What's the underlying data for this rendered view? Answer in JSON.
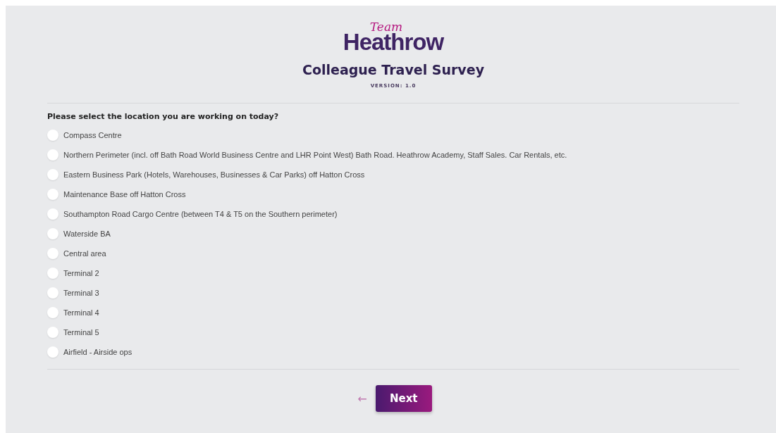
{
  "logo": {
    "top": "Team",
    "main": "Heathrow"
  },
  "title": "Colleague Travel Survey",
  "version": "VERSION: 1.0",
  "question": "Please select the location you are working on today?",
  "options": [
    {
      "label": "Compass Centre",
      "selected": false
    },
    {
      "label": "Northern Perimeter (incl. off Bath Road World Business Centre and LHR Point West) Bath Road. Heathrow Academy, Staff Sales. Car Rentals, etc.",
      "selected": false
    },
    {
      "label": "Eastern Business Park (Hotels, Warehouses, Businesses & Car Parks) off Hatton Cross",
      "selected": false
    },
    {
      "label": "Maintenance Base off Hatton Cross",
      "selected": false
    },
    {
      "label": "Southampton Road Cargo Centre (between T4 & T5 on the Southern perimeter)",
      "selected": false
    },
    {
      "label": "Waterside BA",
      "selected": false
    },
    {
      "label": "Central area",
      "selected": false
    },
    {
      "label": "Terminal 2",
      "selected": false
    },
    {
      "label": "Terminal 3",
      "selected": false
    },
    {
      "label": "Terminal 4",
      "selected": false
    },
    {
      "label": "Terminal 5",
      "selected": false
    },
    {
      "label": "Airfield - Airside ops",
      "selected": false
    }
  ],
  "back": "←",
  "next": "Next"
}
